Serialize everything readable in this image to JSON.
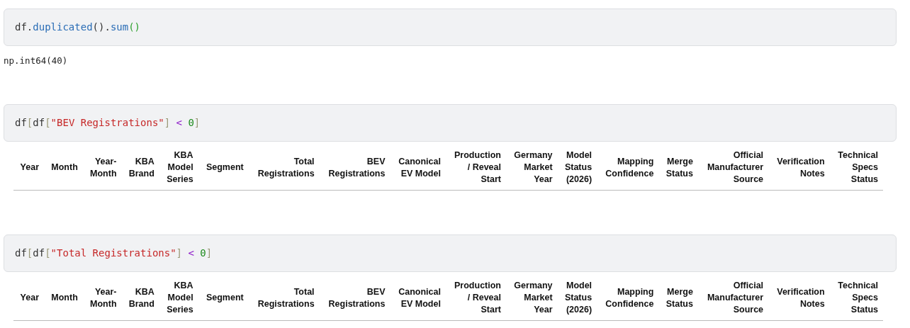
{
  "cells": [
    {
      "input": [
        {
          "kind": "name",
          "text": "df"
        },
        {
          "kind": "plain",
          "text": "."
        },
        {
          "kind": "func",
          "text": "duplicated"
        },
        {
          "kind": "plain",
          "text": "()."
        },
        {
          "kind": "func",
          "text": "sum"
        },
        {
          "kind": "paren",
          "text": "()"
        }
      ],
      "output": {
        "kind": "text",
        "text": "np.int64(40)"
      }
    },
    {
      "input": [
        {
          "kind": "name",
          "text": "df"
        },
        {
          "kind": "bracket",
          "text": "["
        },
        {
          "kind": "name",
          "text": "df"
        },
        {
          "kind": "bracket",
          "text": "["
        },
        {
          "kind": "string",
          "text": "\"BEV Registrations\""
        },
        {
          "kind": "bracket",
          "text": "]"
        },
        {
          "kind": "operator",
          "text": "<"
        },
        {
          "kind": "number",
          "text": "0"
        },
        {
          "kind": "bracket",
          "text": "]"
        }
      ],
      "output": {
        "kind": "table",
        "columns": [
          "Year",
          "Month",
          "Year-Month",
          "KBA Brand",
          "KBA Model Series",
          "Segment",
          "Total Registrations",
          "BEV Registrations",
          "Canonical EV Model",
          "Production / Reveal Start",
          "Germany Market Year",
          "Model Status (2026)",
          "Mapping Confidence",
          "Merge Status",
          "Official Manufacturer Source",
          "Verification Notes",
          "Technical Specs Status"
        ]
      }
    },
    {
      "input": [
        {
          "kind": "name",
          "text": "df"
        },
        {
          "kind": "bracket",
          "text": "["
        },
        {
          "kind": "name",
          "text": "df"
        },
        {
          "kind": "bracket",
          "text": "["
        },
        {
          "kind": "string",
          "text": "\"Total Registrations\""
        },
        {
          "kind": "bracket",
          "text": "]"
        },
        {
          "kind": "operator",
          "text": "<"
        },
        {
          "kind": "number",
          "text": "0"
        },
        {
          "kind": "bracket",
          "text": "]"
        }
      ],
      "output": {
        "kind": "table",
        "columns": [
          "Year",
          "Month",
          "Year-Month",
          "KBA Brand",
          "KBA Model Series",
          "Segment",
          "Total Registrations",
          "BEV Registrations",
          "Canonical EV Model",
          "Production / Reveal Start",
          "Germany Market Year",
          "Model Status (2026)",
          "Mapping Confidence",
          "Merge Status",
          "Official Manufacturer Source",
          "Verification Notes",
          "Technical Specs Status"
        ]
      }
    }
  ]
}
